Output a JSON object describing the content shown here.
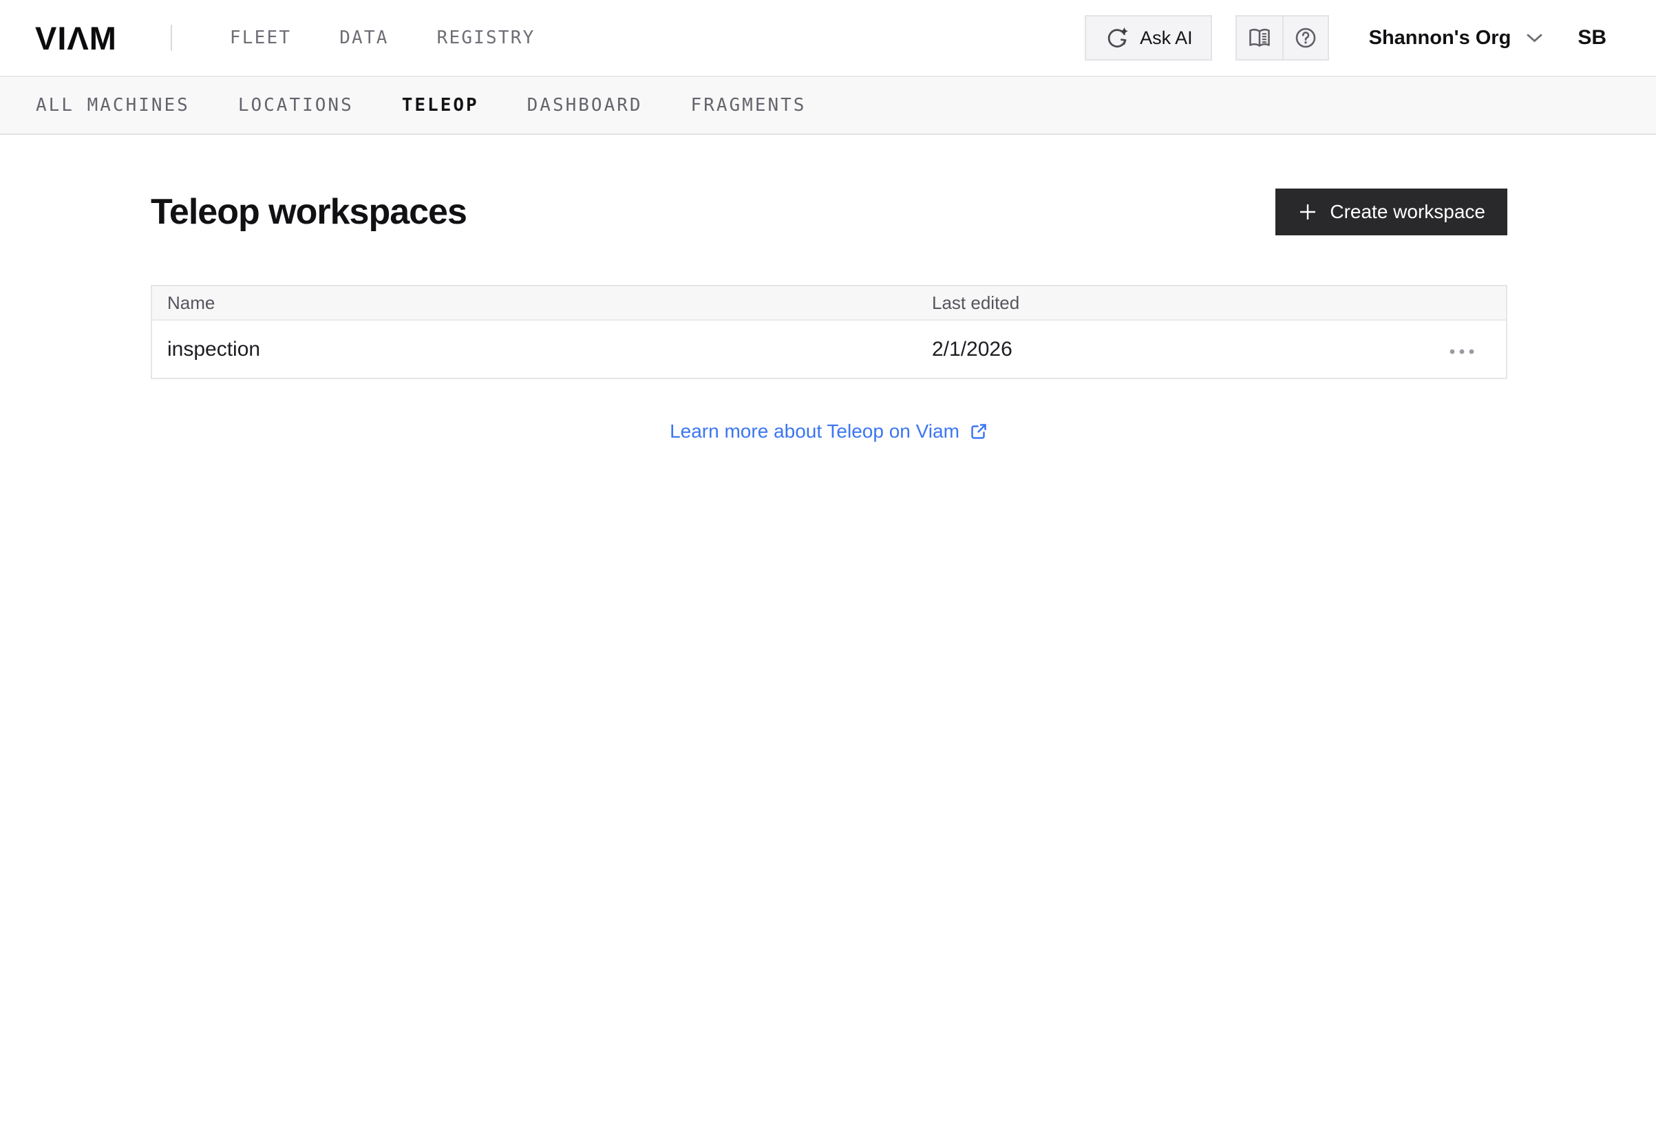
{
  "header": {
    "logo_text": "VIΛM",
    "nav": [
      {
        "label": "FLEET"
      },
      {
        "label": "DATA"
      },
      {
        "label": "REGISTRY"
      }
    ],
    "ask_ai": {
      "label": "Ask AI"
    },
    "org": {
      "name": "Shannon's Org"
    },
    "avatar": {
      "initials": "SB"
    }
  },
  "subnav": {
    "items": [
      {
        "label": "ALL MACHINES",
        "active": false
      },
      {
        "label": "LOCATIONS",
        "active": false
      },
      {
        "label": "TELEOP",
        "active": true
      },
      {
        "label": "DASHBOARD",
        "active": false
      },
      {
        "label": "FRAGMENTS",
        "active": false
      }
    ]
  },
  "main": {
    "title": "Teleop workspaces",
    "create_button": {
      "label": "Create workspace"
    },
    "table": {
      "columns": [
        {
          "label": "Name"
        },
        {
          "label": "Last edited"
        }
      ],
      "rows": [
        {
          "name": "inspection",
          "last_edited": "2/1/2026"
        }
      ]
    },
    "learn_more": {
      "label": "Learn more about Teleop on Viam"
    }
  },
  "colors": {
    "link_blue": "#3b76f0",
    "button_dark": "#29292c",
    "subnav_bg": "#f8f8f9",
    "border": "#e4e4e8",
    "icon_gray": "#5f5f66"
  }
}
